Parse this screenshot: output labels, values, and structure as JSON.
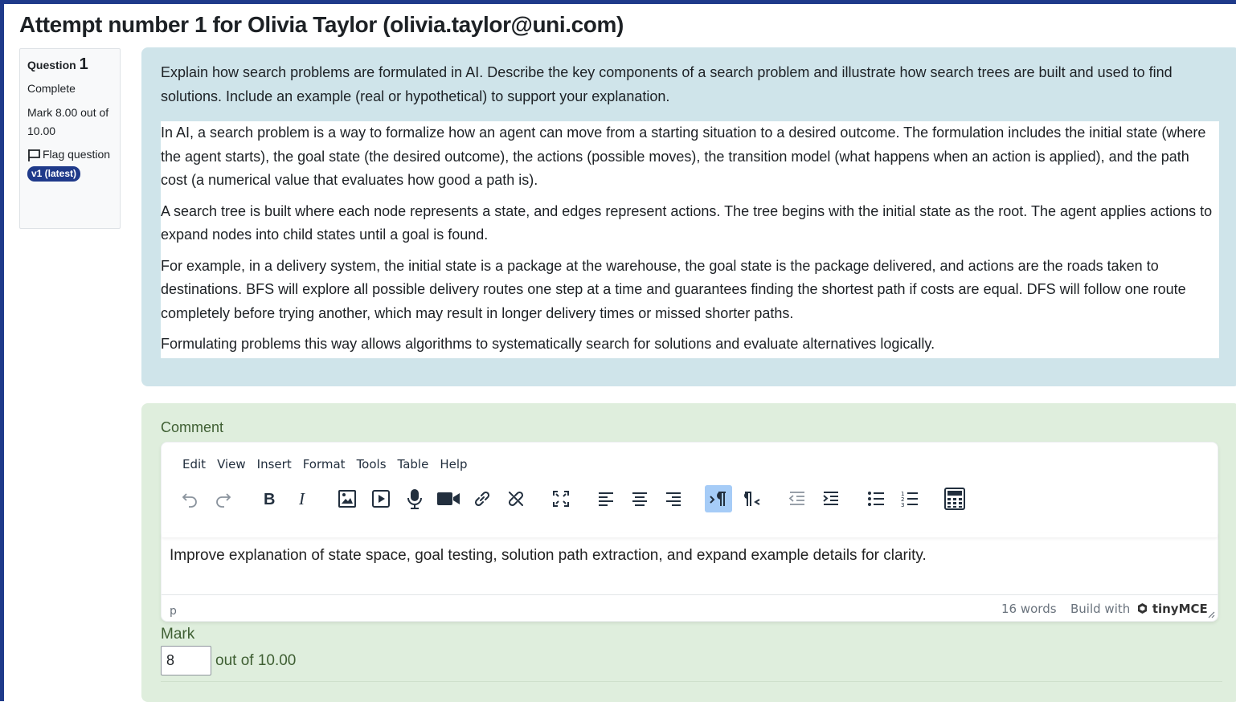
{
  "page": {
    "title": "Attempt number 1 for Olivia Taylor (olivia.taylor@uni.com)"
  },
  "info": {
    "question_label": "Question",
    "question_number": "1",
    "state": "Complete",
    "grade": "Mark 8.00 out of 10.00",
    "flag_label": "Flag question",
    "version_badge": "v1 (latest)"
  },
  "question": {
    "text": "Explain how search problems are formulated in AI. Describe the key components of a search problem and illustrate how search trees are built and used to find solutions. Include an example (real or hypothetical) to support your explanation.",
    "answer": [
      "In AI, a search problem is a way to formalize how an agent can move from a starting situation to a desired outcome. The formulation includes the initial state (where the agent starts), the goal state (the desired outcome), the actions (possible moves), the transition model (what happens when an action is applied), and the path cost (a numerical value that evaluates how good a path is).",
      "A search tree is built where each node represents a state, and edges represent actions. The tree begins with the initial state as the root. The agent applies actions to expand nodes into child states until a goal is found.",
      "For example, in a delivery system, the initial state is a package at the warehouse, the goal state is the package delivered, and actions are the roads taken to destinations. BFS will explore all possible delivery routes one step at a time and guarantees finding the shortest path if costs are equal. DFS will follow one route completely before trying another, which may result in longer delivery times or missed shorter paths.",
      "Formulating problems this way allows algorithms to systematically search for solutions and evaluate alternatives logically."
    ]
  },
  "comment": {
    "label": "Comment",
    "menu": [
      "Edit",
      "View",
      "Insert",
      "Format",
      "Tools",
      "Table",
      "Help"
    ],
    "content": "Improve explanation of state space, goal testing, solution path extraction, and expand example details for clarity.",
    "status_path": "p",
    "word_count": "16 words",
    "brand_prefix": "Build with",
    "brand_name": "tinyMCE",
    "toolbar_icons": [
      "undo-icon",
      "redo-icon",
      "bold-icon",
      "italic-icon",
      "image-icon",
      "media-icon",
      "microphone-icon",
      "video-camera-icon",
      "link-icon",
      "unlink-icon",
      "fullscreen-icon",
      "align-left-icon",
      "align-center-icon",
      "align-right-icon",
      "ltr-icon",
      "rtl-icon",
      "outdent-icon",
      "indent-icon",
      "bullet-list-icon",
      "numbered-list-icon",
      "calculator-icon"
    ]
  },
  "mark": {
    "label": "Mark",
    "value": "8",
    "suffix": "out of 10.00"
  },
  "colors": {
    "question_bg": "#cfe4ea",
    "comment_bg": "#dfeedd",
    "badge": "#1f3a8a",
    "active_button": "#a6ccf7"
  }
}
